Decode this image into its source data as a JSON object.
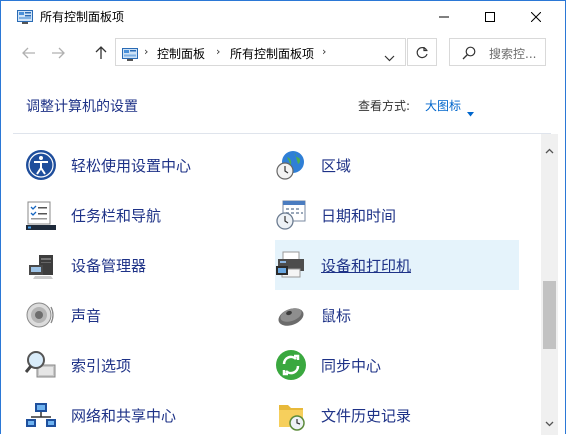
{
  "window": {
    "title": "所有控制面板项",
    "controls": [
      "minimize-icon",
      "maximize-icon",
      "close-icon"
    ]
  },
  "nav": {
    "back_icon": "arrow-left-icon",
    "forward_icon": "arrow-right-icon",
    "up_icon": "arrow-up-icon",
    "breadcrumb": [
      "控制面板",
      "所有控制面板项"
    ],
    "refresh_icon": "refresh-icon",
    "search_placeholder": "搜索控..."
  },
  "header": {
    "heading": "调整计算机的设置",
    "view_by_label": "查看方式:",
    "view_by_value": "大图标"
  },
  "items": [
    {
      "label": "轻松使用设置中心",
      "icon": "ease-of-access-icon"
    },
    {
      "label": "区域",
      "icon": "globe-clock-icon"
    },
    {
      "label": "任务栏和导航",
      "icon": "taskbar-icon"
    },
    {
      "label": "日期和时间",
      "icon": "calendar-clock-icon"
    },
    {
      "label": "设备管理器",
      "icon": "device-manager-icon"
    },
    {
      "label": "设备和打印机",
      "icon": "printer-icon",
      "highlighted": true
    },
    {
      "label": "声音",
      "icon": "speaker-icon"
    },
    {
      "label": "鼠标",
      "icon": "mouse-icon"
    },
    {
      "label": "索引选项",
      "icon": "indexing-icon"
    },
    {
      "label": "同步中心",
      "icon": "sync-icon"
    },
    {
      "label": "网络和共享中心",
      "icon": "network-icon"
    },
    {
      "label": "文件历史记录",
      "icon": "file-history-icon"
    }
  ],
  "colors": {
    "accent": "#2b78d6",
    "link": "#1e3287",
    "highlight": "#e5f3fb"
  }
}
